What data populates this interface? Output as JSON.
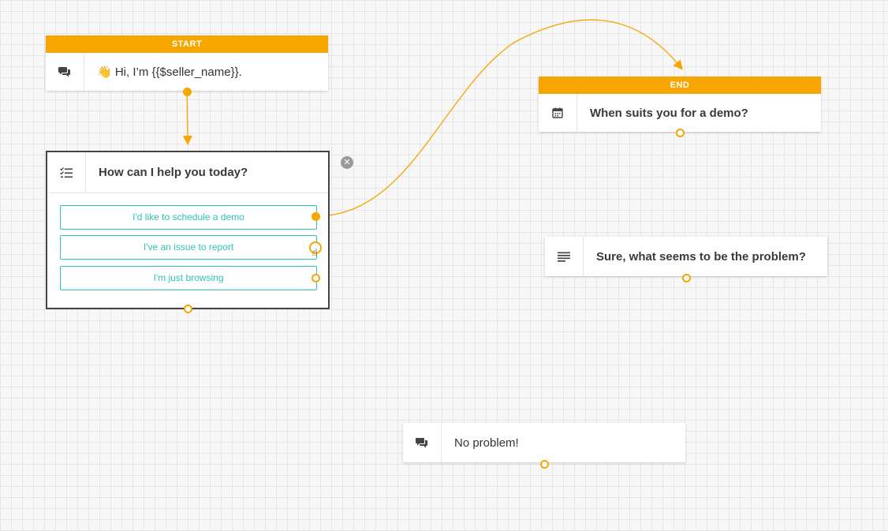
{
  "colors": {
    "accent": "#f7a600",
    "choice": "#2ec4b6",
    "text": "#333333"
  },
  "nodes": {
    "start": {
      "badge": "START",
      "text": "👋 Hi, I’m {{$seller_name}}.",
      "icon": "chat-bubbles-icon"
    },
    "question": {
      "text": "How can I help you today?",
      "icon": "checklist-icon",
      "choices": [
        "I'd like to schedule a demo",
        "I've an issue to report",
        "I'm just browsing"
      ]
    },
    "end": {
      "badge": "END",
      "text": "When suits you for a demo?",
      "icon": "calendar-icon"
    },
    "problem": {
      "text": "Sure, what seems to be the problem?",
      "icon": "text-lines-icon"
    },
    "no_problem": {
      "text": "No problem!",
      "icon": "chat-bubbles-icon"
    }
  }
}
